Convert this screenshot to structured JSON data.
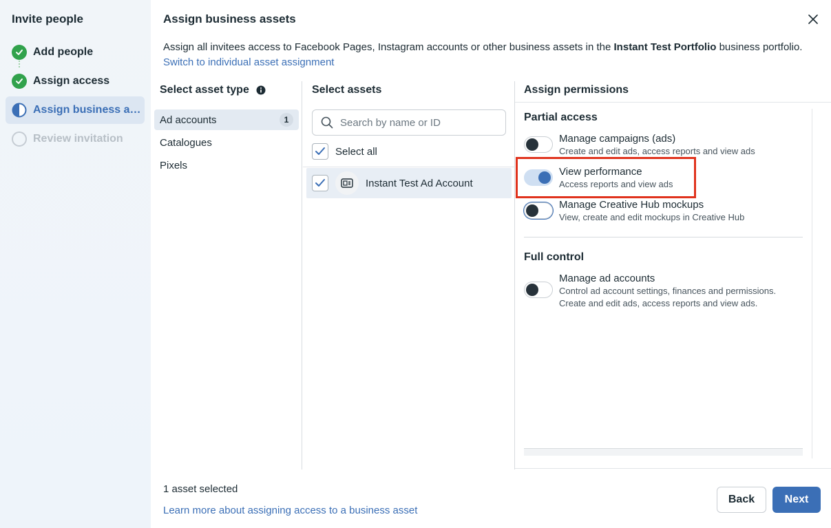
{
  "sidebar": {
    "title": "Invite people",
    "steps": [
      {
        "label": "Add people",
        "status": "done"
      },
      {
        "label": "Assign access",
        "status": "done"
      },
      {
        "label": "Assign business assets",
        "status": "current"
      },
      {
        "label": "Review invitation",
        "status": "pending"
      }
    ]
  },
  "dialog": {
    "title": "Assign business assets",
    "description_pre": "Assign all invitees access to Facebook Pages, Instagram accounts or other business assets in the ",
    "portfolio_name": "Instant Test Portfolio",
    "description_post": " business portfolio. ",
    "switch_link": "Switch to individual asset assignment"
  },
  "asset_types": {
    "header": "Select asset type",
    "items": [
      {
        "label": "Ad accounts",
        "count": "1",
        "active": true
      },
      {
        "label": "Catalogues"
      },
      {
        "label": "Pixels"
      }
    ]
  },
  "assets": {
    "header": "Select assets",
    "search_placeholder": "Search by name or ID",
    "select_all_label": "Select all",
    "items": [
      {
        "name": "Instant Test Ad Account",
        "checked": true
      }
    ]
  },
  "permissions": {
    "header": "Assign permissions",
    "partial_title": "Partial access",
    "partial": [
      {
        "title": "Manage campaigns (ads)",
        "desc": "Create and edit ads, access reports and view ads",
        "on": false
      },
      {
        "title": "View performance",
        "desc": "Access reports and view ads",
        "on": true
      },
      {
        "title": "Manage Creative Hub mockups",
        "desc": "View, create and edit mockups in Creative Hub",
        "on": false
      }
    ],
    "full_title": "Full control",
    "full": [
      {
        "title": "Manage ad accounts",
        "desc": "Control ad account settings, finances and permissions.\nCreate and edit ads, access reports and view ads.",
        "on": false
      }
    ]
  },
  "footer": {
    "selected_text": "1 asset selected",
    "learn_link": "Learn more about assigning access to a business asset",
    "back_label": "Back",
    "next_label": "Next"
  },
  "colors": {
    "accent": "#3b6fb6",
    "success": "#31a24c",
    "highlight": "#e0321c"
  }
}
